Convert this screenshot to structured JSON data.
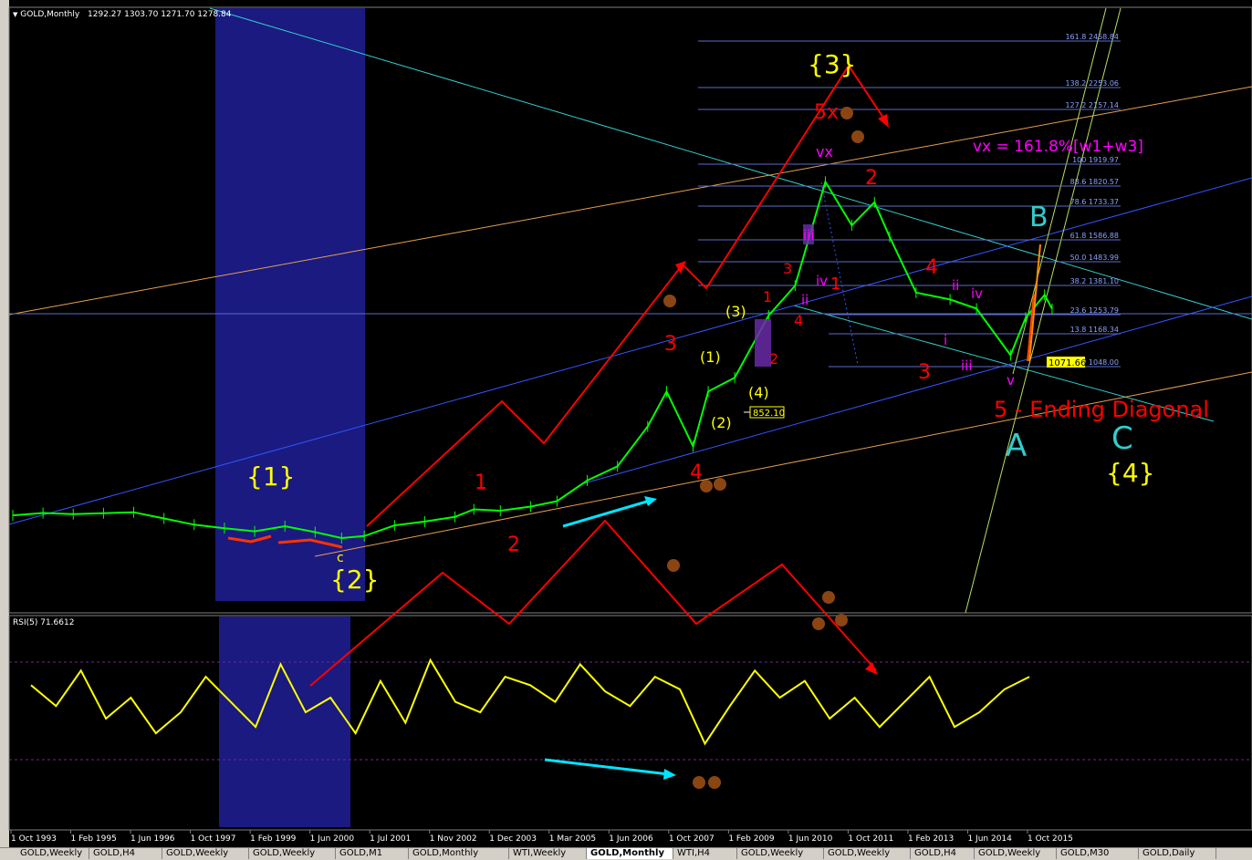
{
  "header": {
    "symbol": "GOLD,Monthly",
    "ohlc": "1292.27 1303.70 1271.70 1278.84",
    "rsi_label": "RSI(5) 71.6612"
  },
  "colors": {
    "price": "#00ff00",
    "rsi": "#ffff00",
    "wave_red": "#ff0000",
    "wave_yellow": "#ffff00",
    "wave_magenta": "#ff00ff",
    "wave_cyan": "#33cccc",
    "band": "#1a1a80",
    "fib_line": "#5c6bc8",
    "channel_blue": "#3355ff",
    "channel_orange": "#e6a050",
    "channel_cyan": "#33cccc"
  },
  "chart_data": {
    "type": "line",
    "title": "GOLD,Monthly",
    "x": [
      "1993-10",
      "1994-06",
      "1995-02",
      "1995-10",
      "1996-06",
      "1997-02",
      "1997-10",
      "1998-06",
      "1999-02",
      "1999-10",
      "2000-06",
      "2001-01",
      "2001-07",
      "2002-03",
      "2002-11",
      "2003-07",
      "2003-12",
      "2004-07",
      "2005-03",
      "2005-10",
      "2006-06",
      "2007-02",
      "2007-10",
      "2008-03",
      "2008-10",
      "2009-02",
      "2009-09",
      "2010-06",
      "2011-01",
      "2011-09",
      "2012-04",
      "2012-10",
      "2013-02",
      "2013-09",
      "2014-06",
      "2015-01",
      "2015-10",
      "2016-02",
      "2016-07",
      "2016-09"
    ],
    "series": [
      {
        "values": [
          370,
          385,
          378,
          384,
          390,
          350,
          310,
          295,
          287,
          300,
          285,
          270,
          275,
          305,
          330,
          360,
          410,
          400,
          430,
          470,
          610,
          660,
          800,
          940,
          730,
          940,
          1000,
          1250,
          1380,
          1840,
          1650,
          1750,
          1600,
          1350,
          1320,
          1280,
          1090,
          1240,
          1340,
          1278.84
        ]
      }
    ],
    "ylabel": "",
    "fib_levels": [
      {
        "label": "161.8 2458.84",
        "value": 2458.84
      },
      {
        "label": "138.2 2253.06",
        "value": 2253.06
      },
      {
        "label": "127.2 2157.14",
        "value": 2157.14
      },
      {
        "label": "100 1919.97",
        "value": 1919.97
      },
      {
        "label": "88.6 1820.57",
        "value": 1820.57
      },
      {
        "label": "78.6 1733.37",
        "value": 1733.37
      },
      {
        "label": "61.8 1586.88",
        "value": 1586.88
      },
      {
        "label": "50.0 1483.99",
        "value": 1483.99
      },
      {
        "label": "38.2 1381.10",
        "value": 1381.1
      },
      {
        "label": "23.6 1253.79",
        "value": 1253.79
      },
      {
        "label": "13.8 1168.34",
        "value": 1168.34
      },
      {
        "label": "0.0 1048.00",
        "value": 1048.0
      }
    ],
    "price_tags": [
      {
        "label": "852.10"
      },
      {
        "label": "1071.66"
      }
    ],
    "x_tick_labels": [
      "1 Oct 1993",
      "1 Feb 1995",
      "1 Jun 1996",
      "1 Oct 1997",
      "1 Feb 1999",
      "1 Jun 2000",
      "1 Jul 2001",
      "1 Nov 2002",
      "1 Dec 2003",
      "1 Mar 2005",
      "1 Jun 2006",
      "1 Oct 2007",
      "1 Feb 2009",
      "1 Jun 2010",
      "1 Oct 2011",
      "1 Feb 2013",
      "1 Jun 2014",
      "1 Oct 2015"
    ],
    "rsi": {
      "name": "RSI(5) 71.6612",
      "values": [
        68,
        58,
        75,
        52,
        62,
        45,
        55,
        72,
        60,
        48,
        78,
        55,
        62,
        45,
        70,
        50,
        80,
        60,
        55,
        72,
        68,
        60,
        78,
        65,
        58,
        72,
        66,
        40,
        58,
        75,
        62,
        70,
        52,
        62,
        48,
        60,
        72,
        48,
        55,
        66,
        72
      ]
    },
    "annotations": {
      "wave_labels": [
        "{1}",
        "{2}",
        "{3}",
        "{4}",
        "5x",
        "vx",
        "1",
        "2",
        "3",
        "4",
        "5 - Ending Diagonal",
        "(1)",
        "(2)",
        "(3)",
        "(4)",
        "i",
        "ii",
        "iii",
        "iv",
        "v",
        "A",
        "B",
        "C",
        "c"
      ],
      "note": "vx = 161.8%[w1+w3]"
    }
  },
  "tabs": [
    {
      "label": "GOLD,Weekly"
    },
    {
      "label": "GOLD,H4"
    },
    {
      "label": "GOLD,Weekly"
    },
    {
      "label": "GOLD,Weekly"
    },
    {
      "label": "GOLD,M1"
    },
    {
      "label": "GOLD,Monthly"
    },
    {
      "label": "WTI,Weekly"
    },
    {
      "label": "GOLD,Monthly"
    },
    {
      "label": "WTI,H4"
    },
    {
      "label": "GOLD,Weekly"
    },
    {
      "label": "GOLD,Weekly"
    },
    {
      "label": "GOLD,H4"
    },
    {
      "label": "GOLD,Weekly"
    },
    {
      "label": "GOLD,M30"
    },
    {
      "label": "GOLD,Daily"
    }
  ],
  "active_tab": 7
}
